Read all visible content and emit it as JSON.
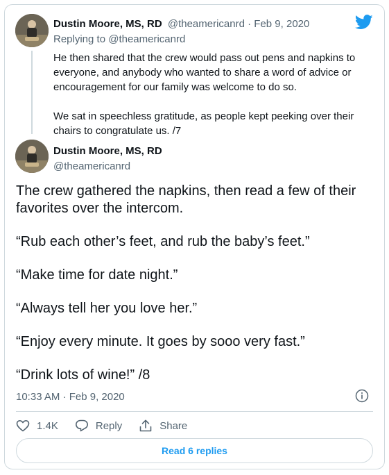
{
  "reply_tweet": {
    "author_name": "Dustin Moore, MS, RD",
    "author_handle": "@theamericanrd",
    "date": "· Feb 9, 2020",
    "replying_to": "Replying to @theamericanrd",
    "paragraphs": [
      "He then shared that the crew would pass out pens and napkins to everyone, and anybody who wanted to share a word of advice or encouragement for our family was welcome to do so.",
      "We sat in speechless gratitude, as people kept peeking over their chairs to congratulate us. /7"
    ]
  },
  "main_tweet": {
    "author_name": "Dustin Moore, MS, RD",
    "author_handle": "@theamericanrd",
    "paragraphs": [
      "The crew gathered the napkins, then read a few of their favorites over the intercom.",
      "“Rub each other’s feet, and rub the baby’s feet.”",
      "“Make time for date night.”",
      "“Always tell her you love her.”",
      "“Enjoy every minute. It goes by sooo very fast.”",
      "“Drink lots of wine!” /8"
    ],
    "timestamp": "10:33 AM · Feb 9, 2020"
  },
  "actions": {
    "like_count": "1.4K",
    "reply_label": "Reply",
    "share_label": "Share"
  },
  "read_replies_label": "Read 6 replies",
  "colors": {
    "accent": "#1d9bf0",
    "muted": "#536471",
    "border": "#cfd9de"
  },
  "icons": [
    "twitter-bird-icon",
    "info-icon",
    "heart-icon",
    "reply-icon",
    "share-icon"
  ]
}
